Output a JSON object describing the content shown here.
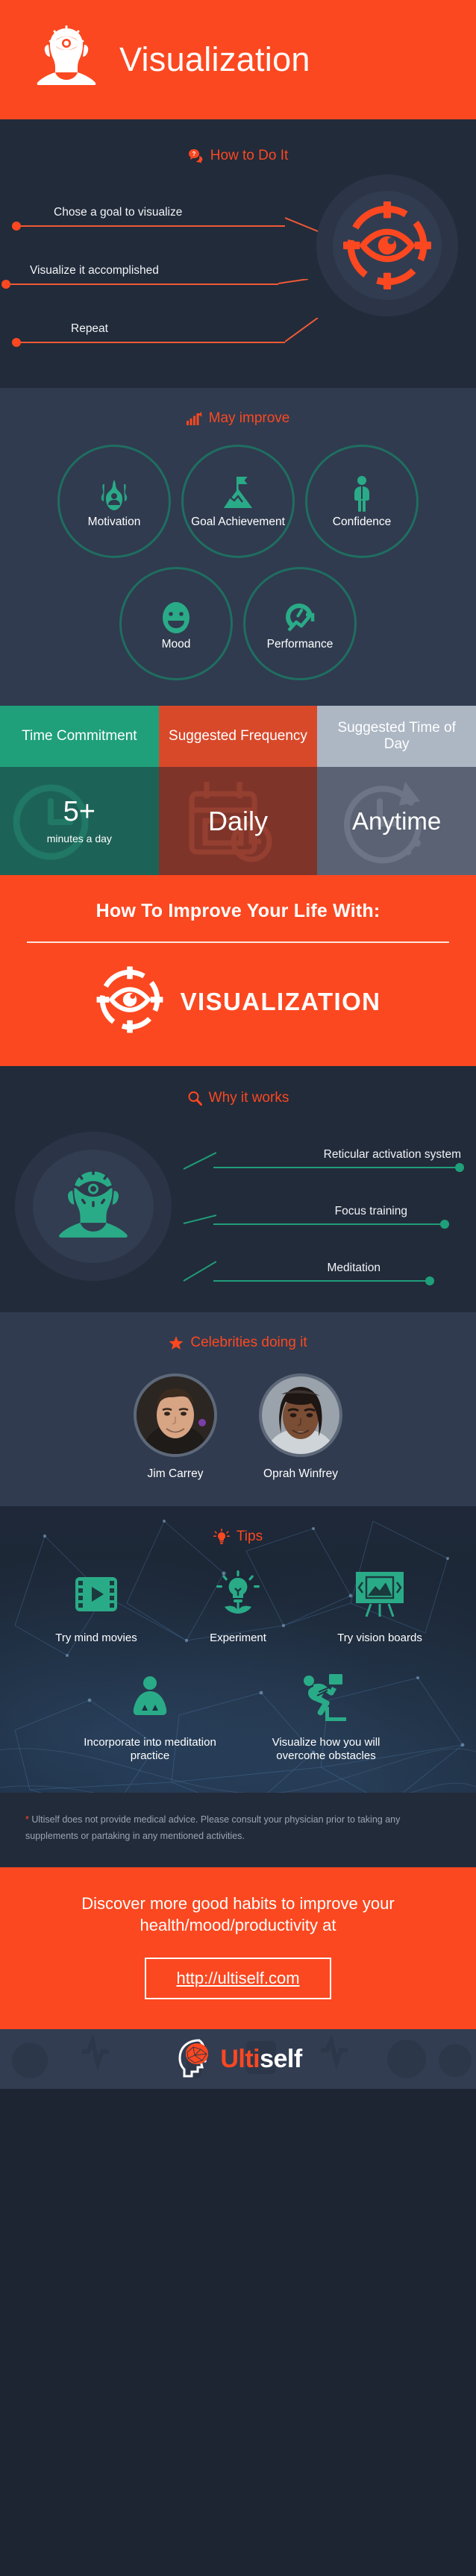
{
  "header": {
    "title": "Visualization",
    "icon": "head-with-third-eye-icon"
  },
  "how_to": {
    "heading": "How to Do It",
    "heading_icon": "question-speech-bubble-icon",
    "steps": [
      "Chose a goal to visualize",
      "Visualize it accomplished",
      "Repeat"
    ],
    "diagram_icon": "eye-target-icon"
  },
  "may_improve": {
    "heading": "May improve",
    "heading_icon": "bar-chart-up-icon",
    "items": [
      {
        "label": "Motivation",
        "icon": "flame-icon"
      },
      {
        "label": "Goal\nAchievement",
        "icon": "mountain-flag-icon"
      },
      {
        "label": "Confidence",
        "icon": "standing-person-icon"
      },
      {
        "label": "Mood",
        "icon": "smiley-face-icon"
      },
      {
        "label": "Performance",
        "icon": "speedometer-icon"
      }
    ]
  },
  "table": {
    "headers": [
      "Time Commitment",
      "Suggested Frequency",
      "Suggested Time of Day"
    ],
    "values": [
      "5+",
      "Daily",
      "Anytime"
    ],
    "sub_values": [
      "minutes a day",
      "",
      ""
    ],
    "bg_icons": [
      "clock-icon",
      "calendar-clock-icon",
      "clock-rotate-icon"
    ],
    "header_colors": [
      "#1fa07a",
      "#d8492a",
      "#adb7c4"
    ],
    "cell_colors": [
      "#1d6257",
      "#7f342a",
      "#5a6273"
    ]
  },
  "promo": {
    "heading": "How To Improve Your Life With:",
    "logo_text": "VISUALIZATION",
    "logo_icon": "eye-target-icon"
  },
  "why_it_works": {
    "heading": "Why it works",
    "heading_icon": "magnifier-icon",
    "items": [
      "Reticular activation system",
      "Focus training",
      "Meditation"
    ],
    "diagram_icon": "head-with-third-eye-icon"
  },
  "celebrities": {
    "heading": "Celebrities doing it",
    "heading_icon": "star-icon",
    "people": [
      {
        "name": "Jim Carrey",
        "photo": "jim-carrey-portrait"
      },
      {
        "name": "Oprah Winfrey",
        "photo": "oprah-winfrey-portrait"
      }
    ]
  },
  "tips": {
    "heading": "Tips",
    "heading_icon": "lightbulb-icon",
    "row1": [
      {
        "label": "Try mind movies",
        "icon": "film-play-icon"
      },
      {
        "label": "Experiment",
        "icon": "lightbulb-plant-icon"
      },
      {
        "label": "Try vision boards",
        "icon": "picture-board-icon"
      }
    ],
    "row2": [
      {
        "label": "Incorporate into meditation practice",
        "icon": "meditating-person-icon"
      },
      {
        "label": "Visualize how you will overcome obstacles",
        "icon": "hurdle-runner-icon"
      }
    ]
  },
  "disclaimer": {
    "star": "*",
    "text": " Ultiself does not provide medical advice. Please consult your physician prior to taking any supplements or partaking in any mentioned activities."
  },
  "cta": {
    "text": "Discover more good habits to improve your health/mood/productivity at",
    "button": "http://ultiself.com"
  },
  "footer": {
    "brand_first": "Ulti",
    "brand_second": "self",
    "logo_icon": "brain-head-icon"
  },
  "colors": {
    "orange": "#fb4820",
    "teal": "#1fa07a",
    "dark": "#222b3a",
    "mid": "#303b4f"
  }
}
